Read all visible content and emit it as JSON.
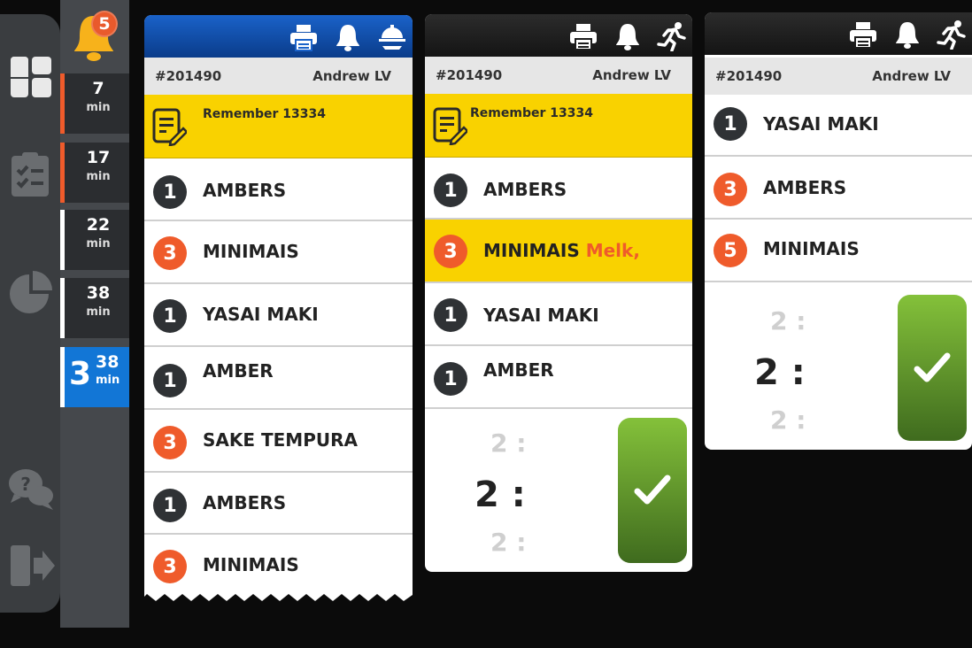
{
  "nav": {
    "icons": [
      "dashboard-icon",
      "clipboard-checklist-icon",
      "pie-chart-icon",
      "help-chat-icon",
      "logout-icon"
    ]
  },
  "notifications": {
    "count": "5",
    "icon": "bell-icon"
  },
  "timers": [
    {
      "value": "7",
      "unit": "min",
      "bar_color": "#ef5b2b"
    },
    {
      "value": "17",
      "unit": "min",
      "bar_color": "#ef5b2b"
    },
    {
      "value": "22",
      "unit": "min",
      "bar_color": "#ffffff"
    },
    {
      "value": "38",
      "unit": "min",
      "bar_color": "#ffffff"
    },
    {
      "prefix": "3",
      "value": "38",
      "unit": "min",
      "bar_color": "#ffffff",
      "active": true
    }
  ],
  "orders": [
    {
      "id": "#201490",
      "user": "Andrew LV",
      "header_icons": [
        "printer-icon",
        "bell-icon",
        "serving-tray-icon"
      ],
      "note": "Remember 13334",
      "items": [
        {
          "qty": "1",
          "name": "AMBERS"
        },
        {
          "qty": "3",
          "name": "MINIMAIS"
        },
        {
          "qty": "1",
          "name": "YASAI MAKI"
        },
        {
          "qty": "1",
          "name": "AMBER"
        },
        {
          "qty": "3",
          "name": "SAKE TEMPURA"
        },
        {
          "qty": "1",
          "name": "AMBERS"
        },
        {
          "qty": "3",
          "name": "MINIMAIS"
        }
      ]
    },
    {
      "id": "#201490",
      "user": "Andrew LV",
      "header_icons": [
        "printer-icon",
        "bell-icon",
        "running-person-icon"
      ],
      "note": "Remember 13334",
      "items": [
        {
          "qty": "1",
          "name": "AMBERS"
        },
        {
          "qty": "3",
          "name": "MINIMAIS",
          "extra": "Melk,"
        },
        {
          "qty": "1",
          "name": "YASAI MAKI"
        },
        {
          "qty": "1",
          "name": "AMBER"
        }
      ],
      "picker": {
        "prev": "2 :",
        "current": "2 :",
        "next": "2 :"
      }
    },
    {
      "id": "#201490",
      "user": "Andrew LV",
      "header_icons": [
        "printer-icon",
        "bell-icon",
        "running-person-icon"
      ],
      "items": [
        {
          "qty": "1",
          "name": "YASAI MAKI"
        },
        {
          "qty": "3",
          "name": "AMBERS"
        },
        {
          "qty": "5",
          "name": "MINIMAIS"
        }
      ],
      "picker": {
        "prev": "2 :",
        "current": "2 :",
        "next": "2 :"
      }
    }
  ],
  "colors": {
    "accent_orange": "#ef5b2b",
    "note_yellow": "#f9d200",
    "active_blue": "#1276d6",
    "done_green": "#6ea532"
  }
}
